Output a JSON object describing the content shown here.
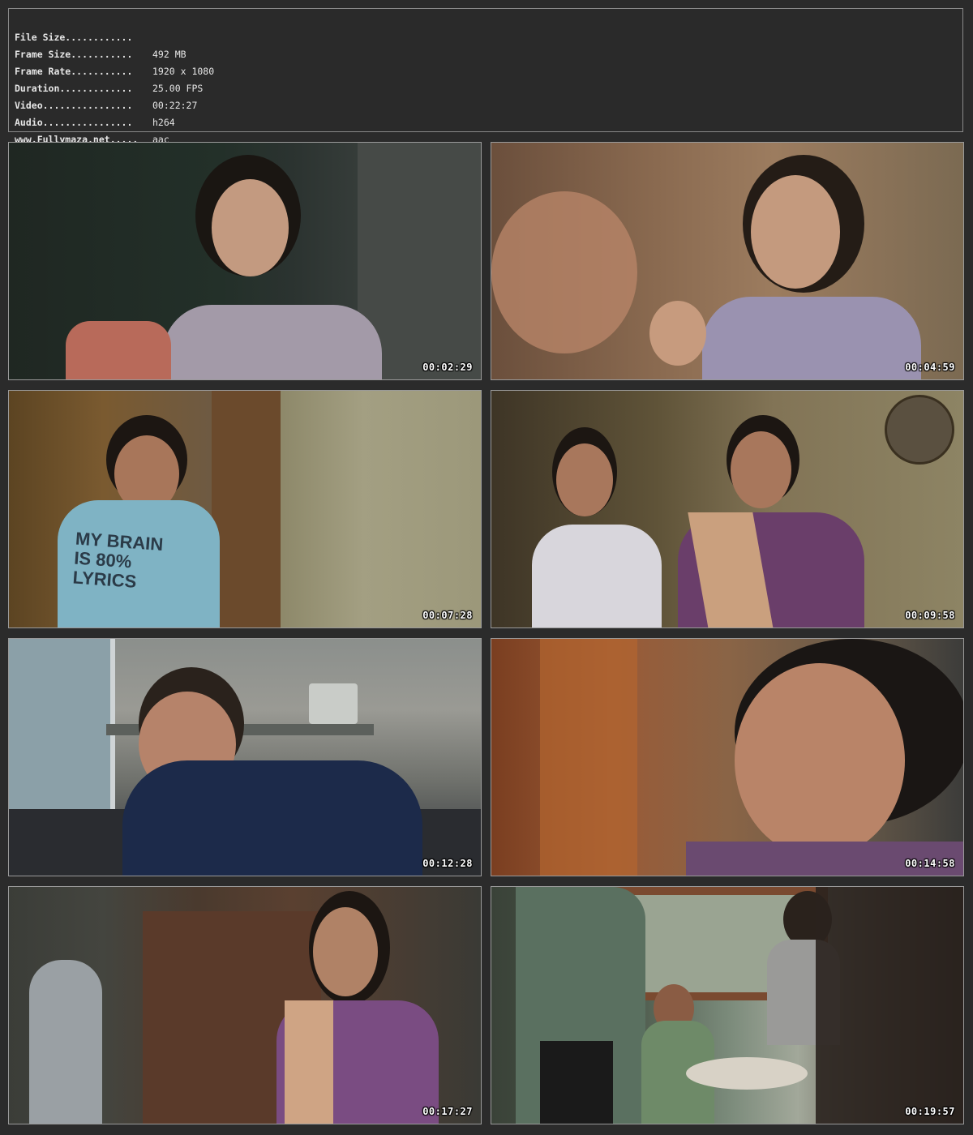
{
  "info": {
    "rows": [
      {
        "label": "File Size............",
        "value": "492 MB"
      },
      {
        "label": "Frame Size...........",
        "value": "1920 x 1080"
      },
      {
        "label": "Frame Rate...........",
        "value": "25.00 FPS"
      },
      {
        "label": "Duration.............",
        "value": "00:22:27"
      },
      {
        "label": "Video................",
        "value": "h264"
      },
      {
        "label": "Audio................",
        "value": "aac"
      }
    ],
    "footer": "www.Fullymaza.net....."
  },
  "thumbnails": [
    {
      "timestamp": "00:02:29"
    },
    {
      "timestamp": "00:04:59"
    },
    {
      "timestamp": "00:07:28"
    },
    {
      "timestamp": "00:09:58"
    },
    {
      "timestamp": "00:12:28"
    },
    {
      "timestamp": "00:14:58"
    },
    {
      "timestamp": "00:17:27"
    },
    {
      "timestamp": "00:19:57"
    }
  ],
  "shirt_text": "MY BRAIN IS 80% LYRICS"
}
